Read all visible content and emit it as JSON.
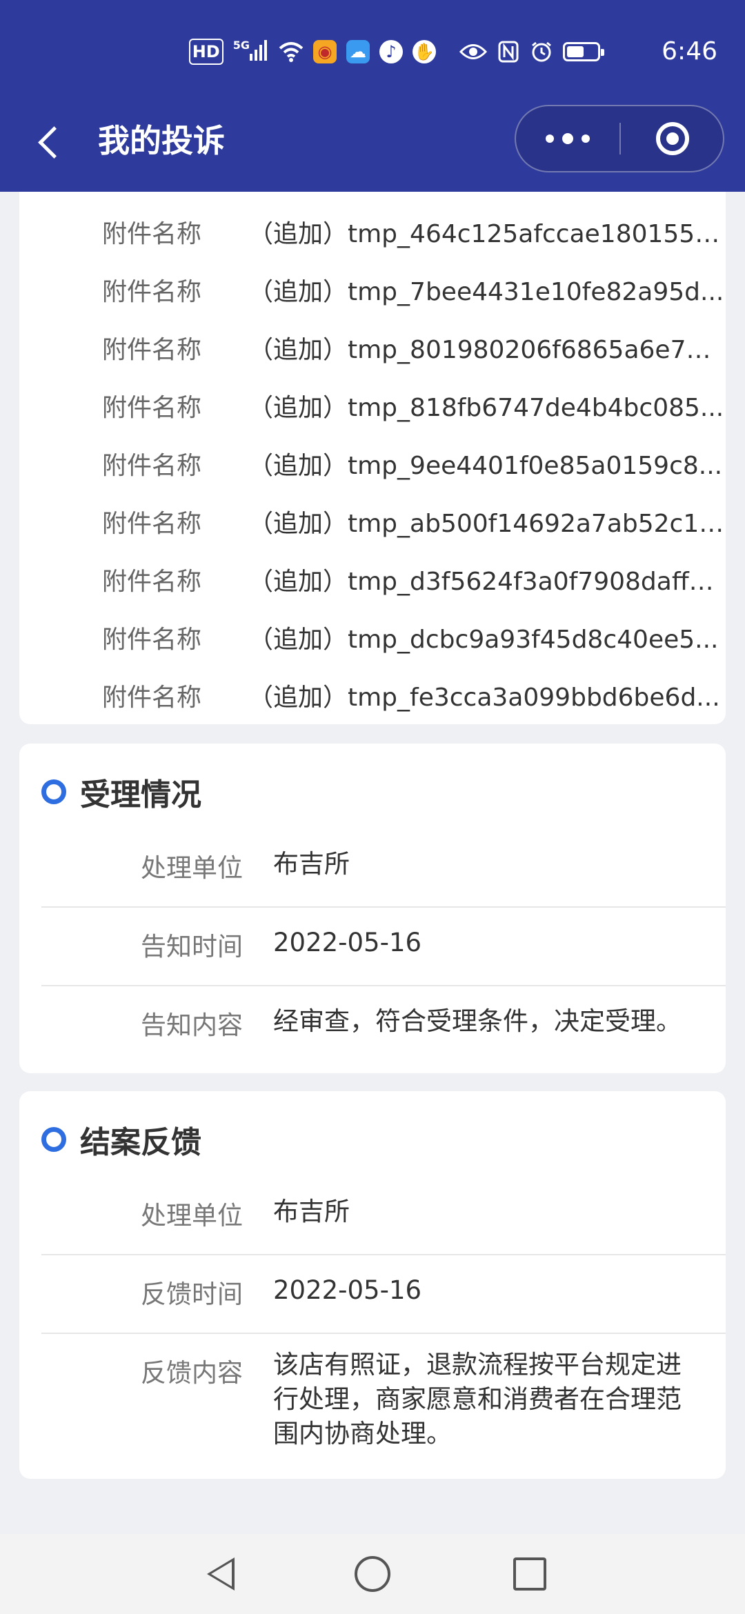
{
  "status_bar": {
    "time": "6:46",
    "network": "5G",
    "hd_label": "HD",
    "icons": [
      "hd-icon",
      "signal-icon",
      "wifi-icon",
      "weibo-icon",
      "cloud-icon",
      "voice-icon",
      "hand-icon",
      "eye-icon",
      "nfc-icon",
      "alarm-icon",
      "battery-icon"
    ]
  },
  "nav": {
    "title": "我的投诉",
    "back_icon": "back-arrow-icon",
    "more_icon": "more-dots-icon",
    "close_icon": "miniapp-close-icon"
  },
  "attachments": {
    "label": "附件名称",
    "items": [
      "（追加）tmp_464c125afccae1801554...",
      "（追加）tmp_7bee4431e10fe82a95d...",
      "（追加）tmp_801980206f6865a6e78...",
      "（追加）tmp_818fb6747de4b4bc085...",
      "（追加）tmp_9ee4401f0e85a0159c8...",
      "（追加）tmp_ab500f14692a7ab52c1f...",
      "（追加）tmp_d3f5624f3a0f7908daffd...",
      "（追加）tmp_dcbc9a93f45d8c40ee5...",
      "（追加）tmp_fe3cca3a099bbd6be6d..."
    ]
  },
  "acceptance": {
    "title": "受理情况",
    "rows": [
      {
        "label": "处理单位",
        "value": "布吉所"
      },
      {
        "label": "告知时间",
        "value": "2022-05-16"
      },
      {
        "label": "告知内容",
        "value": "经审查，符合受理条件，决定受理。"
      }
    ]
  },
  "closure": {
    "title": "结案反馈",
    "rows": [
      {
        "label": "处理单位",
        "value": "布吉所"
      },
      {
        "label": "反馈时间",
        "value": "2022-05-16"
      },
      {
        "label": "反馈内容",
        "value": "该店有照证，退款流程按平台规定进行处理，商家愿意和消费者在合理范围内协商处理。"
      }
    ]
  },
  "colors": {
    "header_bg": "#2e3b9c",
    "accent": "#2f6ee0",
    "page_bg": "#eff0f4"
  }
}
